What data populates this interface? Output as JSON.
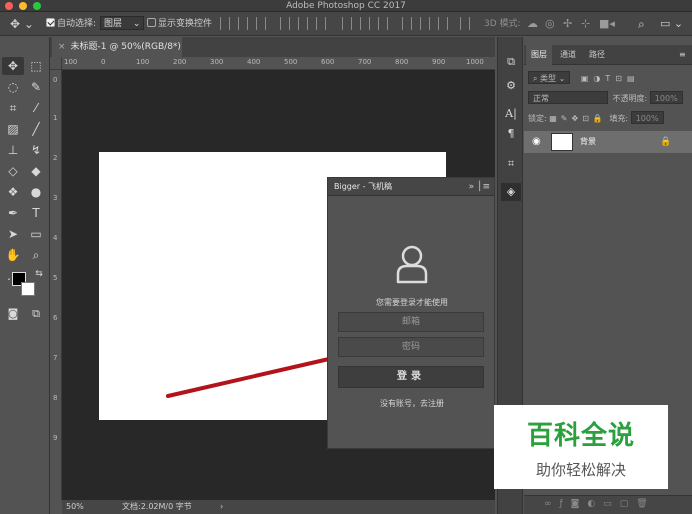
{
  "window": {
    "title": "Adobe Photoshop CC 2017"
  },
  "options_bar": {
    "auto_select_label": "自动选择:",
    "auto_select_value": "图层",
    "show_transform_label": "显示变换控件",
    "mode_3d_label": "3D 模式:"
  },
  "document": {
    "tab_title": "未标题-1 @ 50%(RGB/8*)",
    "zoom": "50%",
    "doc_info": "文档:2.02M/0 字节",
    "ruler_h": [
      "100",
      "0",
      "100",
      "200",
      "300",
      "400",
      "500",
      "600",
      "700",
      "800",
      "900",
      "1000"
    ],
    "ruler_v": [
      "0",
      "1",
      "2",
      "3",
      "4",
      "5",
      "6",
      "7",
      "8",
      "9"
    ]
  },
  "plugin": {
    "title": "Bigger - 飞机稿",
    "message": "您需要登录才能使用",
    "email_placeholder": "邮箱",
    "password_placeholder": "密码",
    "login_label": "登录",
    "register_text": "没有账号，去注册"
  },
  "layers_panel": {
    "tabs": [
      "图层",
      "通道",
      "路径"
    ],
    "filter_label": "类型",
    "blend_mode": "正常",
    "opacity_label": "不透明度:",
    "opacity_value": "100%",
    "lock_label": "锁定:",
    "fill_label": "填充:",
    "fill_value": "100%",
    "layer_name": "背景"
  },
  "watermark": {
    "line1": "百科全说",
    "line2": "助你轻松解决"
  },
  "colors": {
    "arrow": "#b3141b",
    "watermark_green": "#2aa13c"
  }
}
